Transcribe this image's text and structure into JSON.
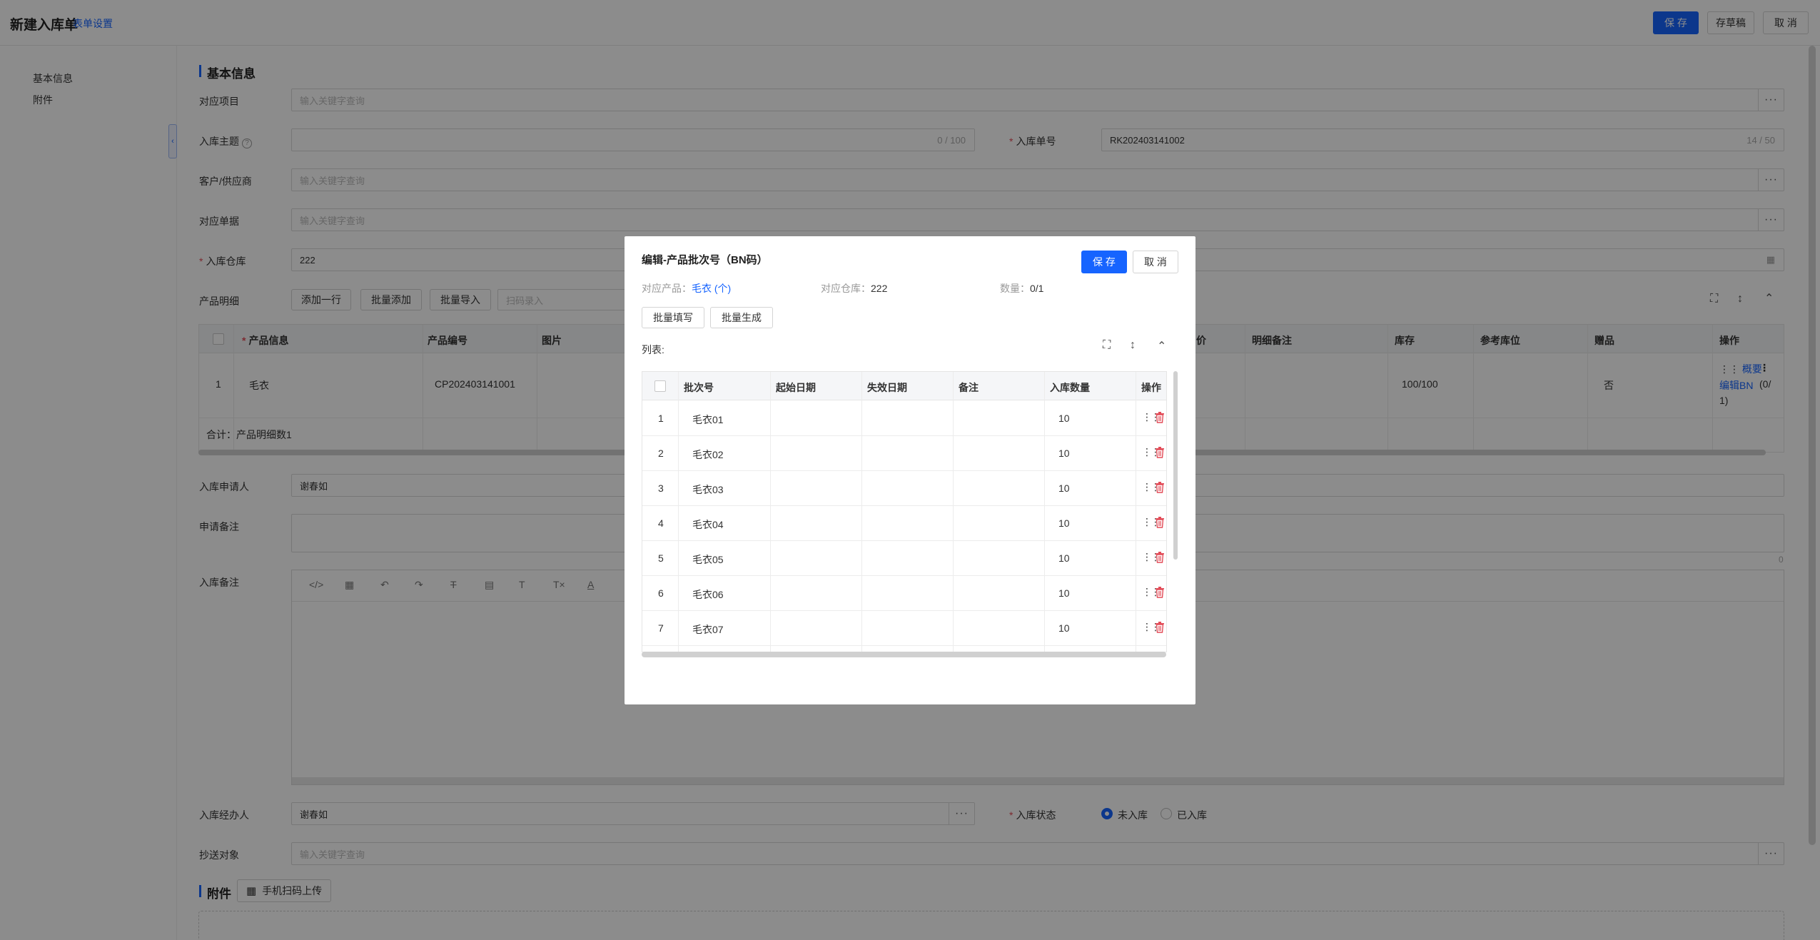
{
  "topbar": {
    "title": "新建入库单",
    "form_settings": "表单设置",
    "save": "保 存",
    "draft": "存草稿",
    "cancel": "取 消"
  },
  "leftnav": {
    "items": [
      "基本信息",
      "附件"
    ]
  },
  "form": {
    "section_basic": "基本信息",
    "project_label": "对应项目",
    "project_placeholder": "输入关键字查询",
    "subject_label": "入库主题",
    "subject_counter": "0 / 100",
    "number_label": "入库单号",
    "number_value": "RK202403141002",
    "number_counter": "14 / 50",
    "customer_label": "客户/供应商",
    "customer_placeholder": "输入关键字查询",
    "document_label": "对应单据",
    "document_placeholder": "输入关键字查询",
    "warehouse_label": "入库仓库",
    "warehouse_value": "222",
    "product_label": "产品明细",
    "add_row": "添加一行",
    "batch_add": "批量添加",
    "batch_import": "批量导入",
    "scan_placeholder": "扫码录入",
    "applicant_label": "入库申请人",
    "applicant_value": "谢春如",
    "apply_note_label": "申请备注",
    "apply_note_count": "0",
    "inbound_note_label": "入库备注",
    "handler_label": "入库经办人",
    "handler_value": "谢春如",
    "status_label": "入库状态",
    "status_not_in": "未入库",
    "status_in": "已入库",
    "cc_label": "抄送对象",
    "cc_placeholder": "输入关键字查询",
    "section_attach": "附件",
    "mobile_upload": "手机扫码上传"
  },
  "product_table": {
    "headers": {
      "product_info": "产品信息",
      "product_code": "产品编号",
      "image": "图片",
      "price": "价",
      "detail_note": "明细备注",
      "stock": "库存",
      "ref_location": "参考库位",
      "gift": "赠品",
      "action": "操作"
    },
    "row": {
      "index": "1",
      "name": "毛衣",
      "code": "CP202403141001",
      "stock": "100/100",
      "gift": "否",
      "action_summary": "概要",
      "action_edit_bn": "编辑BN",
      "action_count_a": "(0/",
      "action_count_b": "1)"
    },
    "total": "合计：产品明细数1"
  },
  "modal": {
    "title": "编辑-产品批次号（BN码）",
    "save": "保 存",
    "cancel": "取 消",
    "product_label": "对应产品：",
    "product_value": "毛衣 (个)",
    "warehouse_label": "对应仓库：",
    "warehouse_value": "222",
    "qty_label": "数量：",
    "qty_value": "0/1",
    "batch_fill": "批量填写",
    "batch_generate": "批量生成",
    "list_label": "列表:",
    "headers": {
      "batch_no": "批次号",
      "start_date": "起始日期",
      "expire_date": "失效日期",
      "note": "备注",
      "qty": "入库数量",
      "action": "操作"
    },
    "rows": [
      {
        "index": "1",
        "batch": "毛衣01",
        "qty": "10"
      },
      {
        "index": "2",
        "batch": "毛衣02",
        "qty": "10"
      },
      {
        "index": "3",
        "batch": "毛衣03",
        "qty": "10"
      },
      {
        "index": "4",
        "batch": "毛衣04",
        "qty": "10"
      },
      {
        "index": "5",
        "batch": "毛衣05",
        "qty": "10"
      },
      {
        "index": "6",
        "batch": "毛衣06",
        "qty": "10"
      },
      {
        "index": "7",
        "batch": "毛衣07",
        "qty": "10"
      }
    ]
  },
  "colors": {
    "primary": "#1664ff",
    "danger": "#e34d59",
    "overlay": "rgba(0,0,0,0.45)"
  }
}
